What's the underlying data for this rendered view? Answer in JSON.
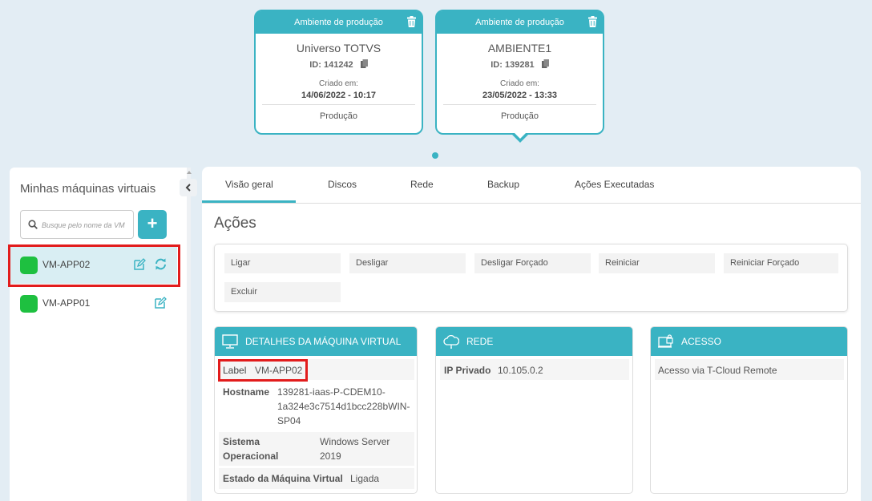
{
  "environments": [
    {
      "header": "Ambiente de produção",
      "name": "Universo TOTVS",
      "id": "ID: 141242",
      "created_label": "Criado em:",
      "created": "14/06/2022 - 10:17",
      "type": "Produção"
    },
    {
      "header": "Ambiente de produção",
      "name": "AMBIENTE1",
      "id": "ID: 139281",
      "created_label": "Criado em:",
      "created": "23/05/2022 - 13:33",
      "type": "Produção"
    }
  ],
  "sidebar": {
    "title": "Minhas máquinas virtuais",
    "search_placeholder": "Busque pelo nome da VM",
    "add_label": "+",
    "vms": [
      {
        "name": "VM-APP02",
        "status_color": "#1ec040"
      },
      {
        "name": "VM-APP01",
        "status_color": "#1ec040"
      }
    ]
  },
  "tabs": [
    "Visão geral",
    "Discos",
    "Rede",
    "Backup",
    "Ações Executadas"
  ],
  "actions": {
    "title": "Ações",
    "buttons": [
      "Ligar",
      "Desligar",
      "Desligar Forçado",
      "Reiniciar",
      "Reiniciar Forçado",
      "Excluir"
    ]
  },
  "details": {
    "title": "DETALHES DA MÁQUINA VIRTUAL",
    "label_key": "Label",
    "label_val": "VM-APP02",
    "hostname_key": "Hostname",
    "hostname_val_1": "139281-iaas-P-CDEM10-",
    "hostname_val_2": "1a324e3c7514d1bcc228bWIN-",
    "hostname_val_3": "SP04",
    "os_key_1": "Sistema",
    "os_key_2": "Operacional",
    "os_val_1": "Windows Server",
    "os_val_2": "2019",
    "state_key": "Estado da Máquina Virtual",
    "state_val": "Ligada"
  },
  "network": {
    "title": "REDE",
    "ip_key": "IP Privado",
    "ip_val": "10.105.0.2"
  },
  "access": {
    "title": "ACESSO",
    "text": "Acesso via T-Cloud Remote"
  },
  "colors": {
    "accent": "#3ab3c3",
    "highlight": "#e21c1c",
    "status_on": "#1ec040",
    "selected_bg": "#d9eef3"
  },
  "icons": [
    "trash-icon",
    "copy-icon",
    "search-icon",
    "edit-icon",
    "refresh-icon",
    "chevron-left-icon",
    "monitor-icon",
    "cloud-icon",
    "lock-icon"
  ]
}
